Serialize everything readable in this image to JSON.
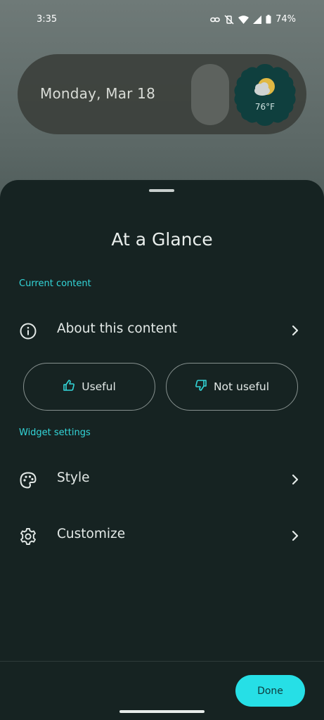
{
  "status_bar": {
    "time": "3:35",
    "battery_percent": "74%",
    "icons": [
      "link-icon",
      "vibrate-off-icon",
      "wifi-icon",
      "signal-icon",
      "battery-icon"
    ]
  },
  "widget": {
    "date": "Monday, Mar 18",
    "temperature": "76°F",
    "weather_icon": "partly-cloudy-icon"
  },
  "sheet": {
    "title": "At a Glance",
    "current_content_label": "Current content",
    "about_label": "About this content",
    "useful_label": "Useful",
    "not_useful_label": "Not useful",
    "widget_settings_label": "Widget settings",
    "style_label": "Style",
    "customize_label": "Customize",
    "done_label": "Done"
  },
  "colors": {
    "accent": "#26dfe6",
    "section_label": "#33d6d9",
    "sheet_bg": "#162322"
  }
}
